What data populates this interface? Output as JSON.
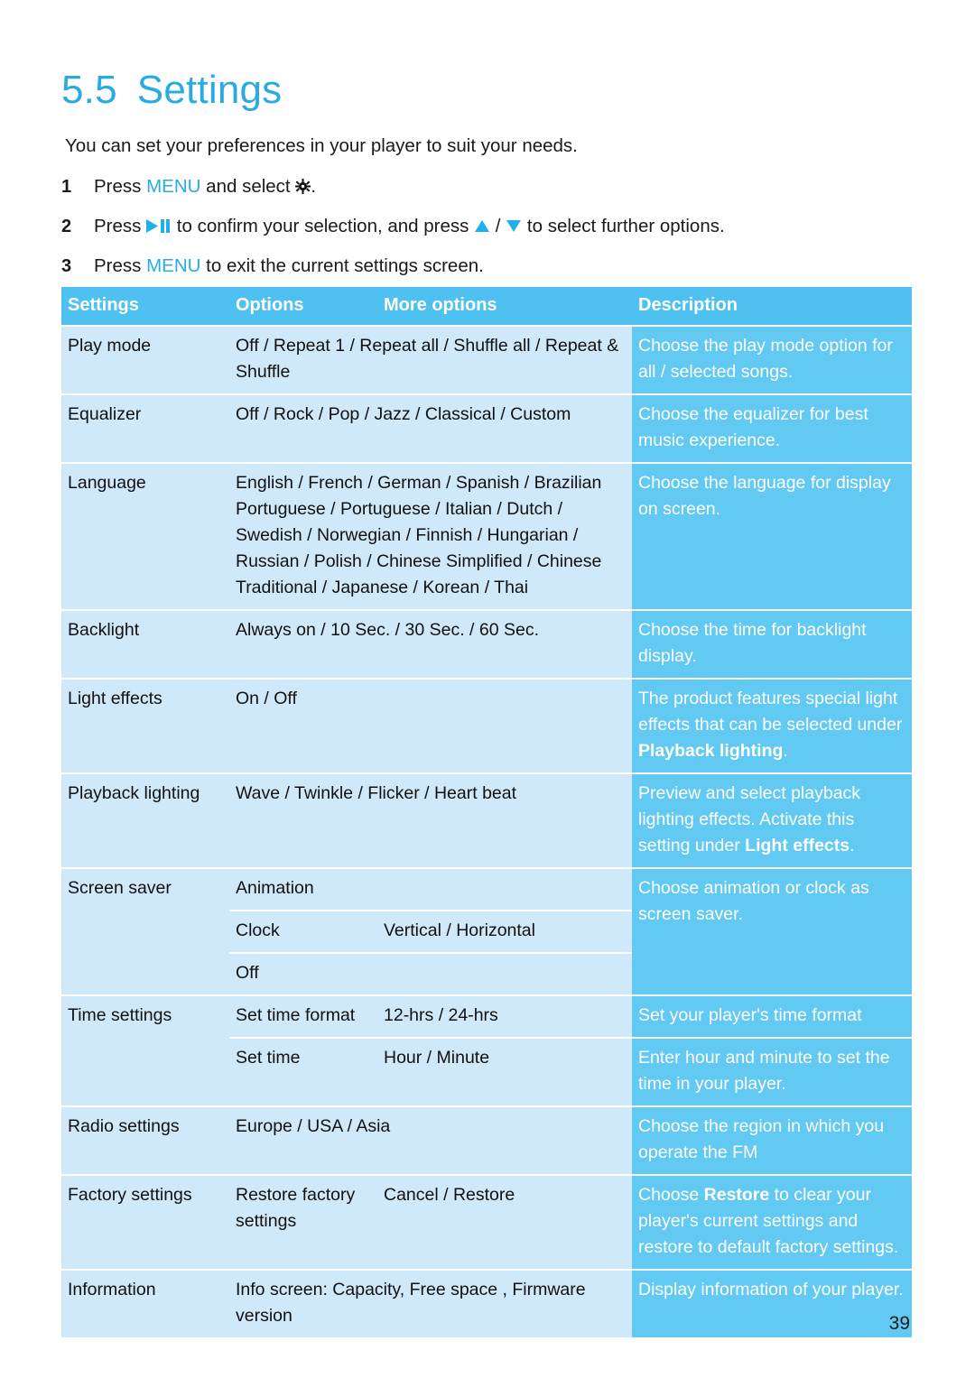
{
  "heading": {
    "number": "5.5",
    "title": "Settings"
  },
  "intro": "You can set your preferences in your player to suit your needs.",
  "steps": [
    {
      "index": "1",
      "before": "Press ",
      "keyword": "MENU",
      "middle": " and select ",
      "icon": "gear-icon",
      "after": "."
    },
    {
      "index": "2",
      "before": "Press ",
      "icon1": "play-pause-icon",
      "middle": " to confirm your selection, and press ",
      "icon2": "triangle-up-icon",
      "separator": " / ",
      "icon3": "triangle-down-icon",
      "after": " to select further options."
    },
    {
      "index": "3",
      "before": "Press ",
      "keyword": "MENU",
      "after": " to exit the current settings screen."
    }
  ],
  "table": {
    "headers": {
      "settings": "Settings",
      "options": "Options",
      "more_options": "More options",
      "description": "Description"
    },
    "rows": [
      {
        "setting": "Play mode",
        "options": "Off / Repeat 1 / Repeat all / Shuffle all / Repeat & Shuffle",
        "more_options": "",
        "description": "Choose the play mode option for all / selected songs."
      },
      {
        "setting": "Equalizer",
        "options": "Off / Rock / Pop / Jazz / Classical / Custom",
        "more_options": "",
        "description": "Choose the equalizer for best music experience."
      },
      {
        "setting": "Language",
        "options": "English / French / German / Spanish / Brazilian Portuguese / Portuguese / Italian / Dutch / Swedish / Norwegian / Finnish / Hungarian / Russian / Polish / Chinese Simplified / Chinese Traditional / Japanese / Korean / Thai",
        "more_options": "",
        "description": "Choose the language for display on screen."
      },
      {
        "setting": "Backlight",
        "options": "Always on / 10 Sec. / 30 Sec. / 60 Sec.",
        "more_options": "",
        "description": "Choose the time for backlight display."
      },
      {
        "setting": "Light effects",
        "options": "On / Off",
        "more_options": "",
        "description_parts": {
          "pre": "The product features special light effects that can be selected under ",
          "bold": "Playback lighting",
          "post": "."
        }
      },
      {
        "setting": "Playback lighting",
        "options": "Wave / Twinkle / Flicker / Heart beat",
        "more_options": "",
        "description_parts": {
          "pre": "Preview and select playback lighting effects. Activate this setting under ",
          "bold": "Light effects",
          "post": "."
        }
      },
      {
        "setting": "Screen saver",
        "subrows": [
          {
            "options": "Animation",
            "more_options": ""
          },
          {
            "options": "Clock",
            "more_options": "Vertical / Horizontal"
          },
          {
            "options": "Off",
            "more_options": ""
          }
        ],
        "description": "Choose animation or clock as screen saver."
      },
      {
        "setting": "Time settings",
        "subrows": [
          {
            "options": "Set time format",
            "more_options": "12-hrs / 24-hrs",
            "description": "Set your player's time format"
          },
          {
            "options": "Set time",
            "more_options": "Hour / Minute",
            "description": "Enter hour and minute to set the time in your player."
          }
        ]
      },
      {
        "setting": "Radio settings",
        "options": "Europe / USA / Asia",
        "more_options": "",
        "description": "Choose the region in which you operate the FM"
      },
      {
        "setting": "Factory settings",
        "options": "Restore factory settings",
        "more_options": "Cancel / Restore",
        "description_parts": {
          "pre": "Choose ",
          "bold": "Restore",
          "post": " to clear your player's current settings and restore to default factory settings."
        }
      },
      {
        "setting": "Information",
        "options": "Info screen: Capacity, Free space , Firmware version",
        "more_options": "",
        "description": "Display information of your player."
      }
    ]
  },
  "page_number": "39",
  "colors": {
    "accent": "#29abe2",
    "header_bar": "#4fc1f0",
    "cell_bg": "#cfe8fa",
    "desc_bg": "#62c9f2"
  }
}
